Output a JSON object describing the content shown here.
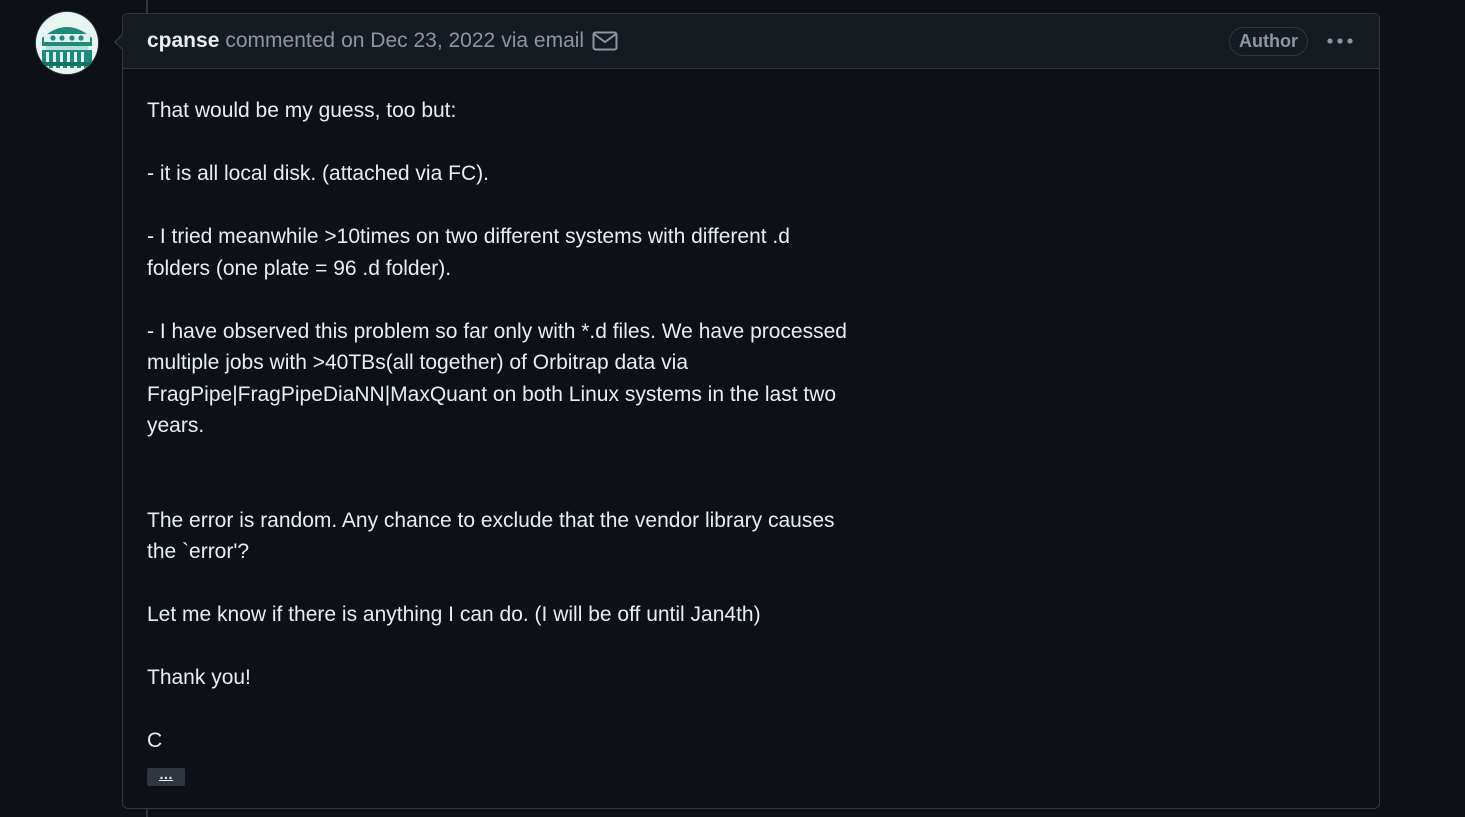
{
  "comment": {
    "author": "cpanse",
    "action": "commented",
    "date": "on Dec 23, 2022",
    "via": "via email",
    "badge": "Author",
    "body": [
      "That would be my guess, too but:",
      "- it is all local disk. (attached via FC).",
      "- I tried meanwhile >10times on two different systems with different .d folders (one plate = 96 .d folder).",
      "- I have observed this problem so far only with *.d files. We have processed multiple jobs with >40TBs(all together) of Orbitrap data via FragPipe|FragPipeDiaNN|MaxQuant on both Linux systems in the last two years.",
      "The error is random. Any chance to exclude that the vendor library causes the `error'?",
      "Let me know if there is anything I can do. (I will be off until Jan4th)",
      "Thank you!",
      "C"
    ],
    "expand_label": "…"
  },
  "icons": {
    "mail": "mail-icon",
    "more": "kebab-horizontal-icon",
    "avatar": "identicon-avatar"
  },
  "colors": {
    "background": "#0d1117",
    "header_bg": "#161b22",
    "border": "#30363d",
    "text": "#e6edf3",
    "muted": "#8d96a0",
    "avatar_accent": "#1f8a7a"
  }
}
